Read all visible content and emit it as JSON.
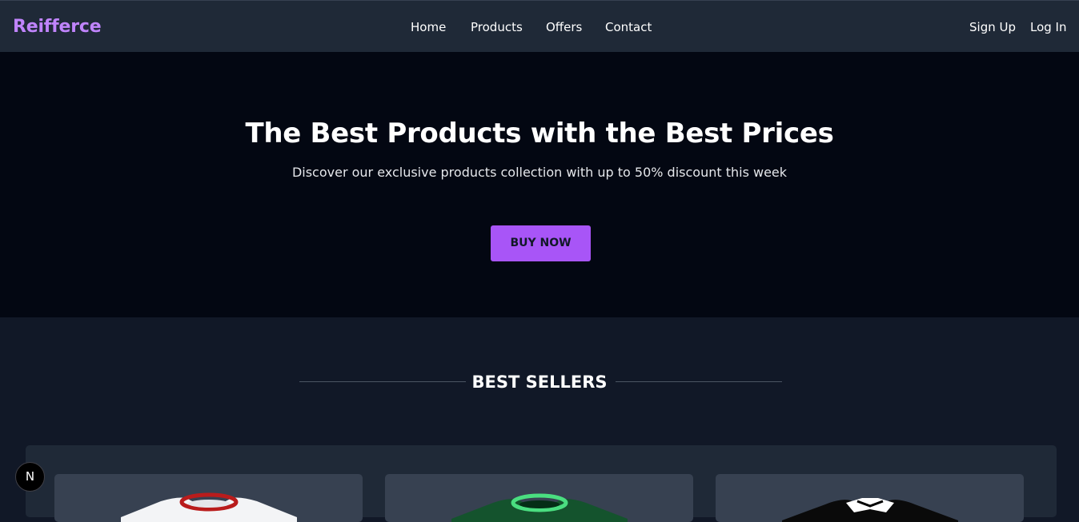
{
  "nav": {
    "brand": "Reifferce",
    "links": [
      "Home",
      "Products",
      "Offers",
      "Contact"
    ],
    "sign_up": "Sign Up",
    "log_in": "Log In"
  },
  "hero": {
    "title": "The Best Products with the Best Prices",
    "subtitle": "Discover our exclusive products collection with up to 50% discount this week",
    "cta": "BUY NOW"
  },
  "best_sellers": {
    "title": "BEST SELLERS",
    "products": [
      {
        "icon": "white-tshirt-red-collar-icon"
      },
      {
        "icon": "green-tshirt-neon-collar-icon"
      },
      {
        "icon": "black-white-tshirt-icon"
      }
    ]
  },
  "badge": {
    "label": "N"
  },
  "colors": {
    "navbar_bg": "#1f2937",
    "hero_bg": "#030712",
    "page_bg": "#111827",
    "accent": "#a855f7",
    "brand": "#c084fc"
  }
}
